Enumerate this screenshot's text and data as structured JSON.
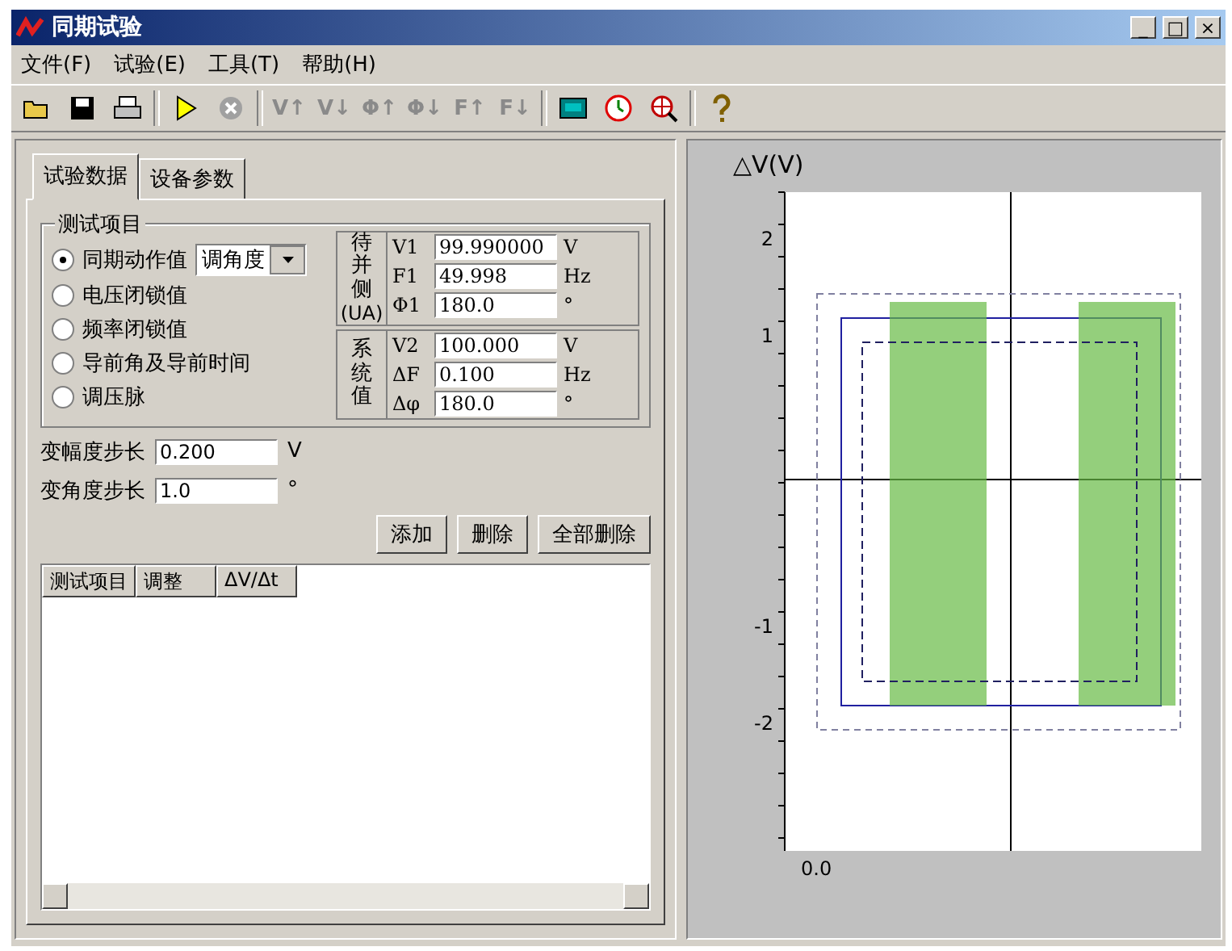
{
  "window": {
    "title": "同期试验",
    "controls": [
      "_",
      "□",
      "×"
    ]
  },
  "menu": [
    "文件(F)",
    "试验(E)",
    "工具(T)",
    "帮助(H)"
  ],
  "toolbar": [
    {
      "kind": "open"
    },
    {
      "kind": "save"
    },
    {
      "kind": "print"
    },
    {
      "kind": "sep"
    },
    {
      "kind": "play"
    },
    {
      "kind": "stop"
    },
    {
      "kind": "sep"
    },
    {
      "kind": "text",
      "label": "V↑",
      "disabled": true
    },
    {
      "kind": "text",
      "label": "V↓",
      "disabled": true
    },
    {
      "kind": "text",
      "label": "Φ↑",
      "disabled": true
    },
    {
      "kind": "text",
      "label": "Φ↓",
      "disabled": true
    },
    {
      "kind": "text",
      "label": "F↑",
      "disabled": true
    },
    {
      "kind": "text",
      "label": "F↓",
      "disabled": true
    },
    {
      "kind": "sep"
    },
    {
      "kind": "calc"
    },
    {
      "kind": "clock"
    },
    {
      "kind": "zoom"
    },
    {
      "kind": "sep"
    },
    {
      "kind": "help"
    }
  ],
  "tabs": [
    {
      "label": "试验数据",
      "selected": true
    },
    {
      "label": "设备参数",
      "selected": false
    }
  ],
  "test_items": {
    "title": "测试项目",
    "dropdown": "调角度",
    "options": [
      {
        "label": "同期动作值",
        "selected": true
      },
      {
        "label": "电压闭锁值",
        "selected": false
      },
      {
        "label": "频率闭锁值",
        "selected": false
      },
      {
        "label": "导前角及导前时间",
        "selected": false
      },
      {
        "label": "调压脉",
        "selected": false
      }
    ]
  },
  "params": [
    {
      "side": "待并侧",
      "sub": "(UA)",
      "rows": [
        {
          "name": "V1",
          "value": "99.990000",
          "unit": "V"
        },
        {
          "name": "F1",
          "value": "49.998",
          "unit": "Hz"
        },
        {
          "name": "Φ1",
          "value": "180.0",
          "unit": "°"
        }
      ]
    },
    {
      "side": "系统值",
      "rows": [
        {
          "name": "V2",
          "value": "100.000",
          "unit": "V"
        },
        {
          "name": "ΔF",
          "value": "0.100",
          "unit": "Hz"
        },
        {
          "name": "Δφ",
          "value": "180.0",
          "unit": "°"
        }
      ]
    }
  ],
  "steps": [
    {
      "label": "变幅度步长",
      "value": "0.200",
      "unit": "V"
    },
    {
      "label": "变角度步长",
      "value": "1.0",
      "unit": "°"
    }
  ],
  "buttons": [
    "添加",
    "删除",
    "全部删除"
  ],
  "table": {
    "columns": [
      "测试项目",
      "调整",
      "ΔV/Δt"
    ]
  },
  "chart": {
    "ylabel": "△V(V)",
    "yticks": [
      "2",
      "1",
      "-1",
      "-2"
    ],
    "xticks": [
      "0.0"
    ]
  }
}
